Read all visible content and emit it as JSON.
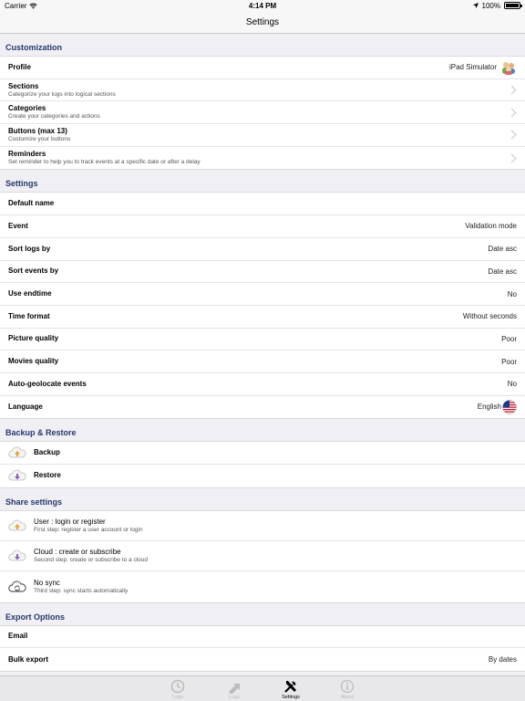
{
  "status": {
    "carrier": "Carrier",
    "time": "4:14 PM",
    "battery": "100%"
  },
  "nav": {
    "title": "Settings"
  },
  "customization": {
    "header": "Customization",
    "profile": {
      "label": "Profile",
      "value": "iPad Simulator"
    },
    "sections": {
      "label": "Sections",
      "sub": "Categorize your logs into logical sections"
    },
    "categories": {
      "label": "Categories",
      "sub": "Create your categories and actions"
    },
    "buttons": {
      "label": "Buttons (max 13)",
      "sub": "Customize your buttons"
    },
    "reminders": {
      "label": "Reminders",
      "sub": "Set reminder to help you to track events at a specific date or after a delay"
    }
  },
  "settings": {
    "header": "Settings",
    "rows": [
      {
        "label": "Default name",
        "value": ""
      },
      {
        "label": "Event",
        "value": "Validation mode"
      },
      {
        "label": "Sort logs by",
        "value": "Date asc"
      },
      {
        "label": "Sort events by",
        "value": "Date asc"
      },
      {
        "label": "Use endtime",
        "value": "No"
      },
      {
        "label": "Time format",
        "value": "Without seconds"
      },
      {
        "label": "Picture quality",
        "value": "Poor"
      },
      {
        "label": "Movies quality",
        "value": "Poor"
      },
      {
        "label": "Auto-geolocate events",
        "value": "No"
      },
      {
        "label": "Language",
        "value": "English"
      }
    ]
  },
  "backup": {
    "header": "Backup & Restore",
    "backup_label": "Backup",
    "restore_label": "Restore"
  },
  "share": {
    "header": "Share settings",
    "user": {
      "label": "User : login or register",
      "sub": "First step: register a user account or login"
    },
    "cloud": {
      "label": "Cloud : create or subscribe",
      "sub": "Second step: create or subscribe to a cloud"
    },
    "nosync": {
      "label": "No sync",
      "sub": "Third step: sync starts automatically"
    }
  },
  "export": {
    "header": "Export Options",
    "email_label": "Email",
    "bulk_label": "Bulk export",
    "bulk_value": "By dates"
  },
  "tabs": {
    "logs_clock": "Logs",
    "logs_arrow": "Logs",
    "settings": "Settings",
    "about": "About"
  },
  "colors": {
    "section_header": "#28386d",
    "background": "#efeff4",
    "up_arrow": "#e8a030",
    "down_arrow": "#8a5cc0"
  }
}
